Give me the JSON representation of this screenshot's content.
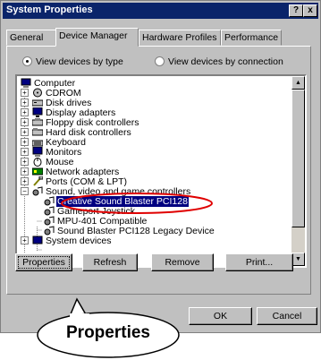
{
  "window": {
    "title": "System Properties",
    "help_button": "?",
    "close_button": "x"
  },
  "tabs": [
    {
      "label": "General"
    },
    {
      "label": "Device Manager"
    },
    {
      "label": "Hardware Profiles"
    },
    {
      "label": "Performance"
    }
  ],
  "view_options": {
    "by_type": "View devices by type",
    "by_connection": "View devices by connection",
    "selected": "by_type"
  },
  "tree": {
    "items": [
      {
        "label": "Computer",
        "icon": "computer-icon"
      },
      {
        "label": "CDROM",
        "icon": "cdrom-icon"
      },
      {
        "label": "Disk drives",
        "icon": "disk-drive-icon"
      },
      {
        "label": "Display adapters",
        "icon": "display-adapter-icon"
      },
      {
        "label": "Floppy disk controllers",
        "icon": "floppy-controller-icon"
      },
      {
        "label": "Hard disk controllers",
        "icon": "hard-disk-controller-icon"
      },
      {
        "label": "Keyboard",
        "icon": "keyboard-icon"
      },
      {
        "label": "Monitors",
        "icon": "monitor-icon"
      },
      {
        "label": "Mouse",
        "icon": "mouse-icon"
      },
      {
        "label": "Network adapters",
        "icon": "network-adapter-icon"
      },
      {
        "label": "Ports (COM & LPT)",
        "icon": "ports-icon"
      },
      {
        "label": "Sound, video and game controllers",
        "icon": "sound-controller-icon"
      },
      {
        "label": "Creative Sound Blaster PCI128",
        "icon": "sound-device-icon",
        "selected": true
      },
      {
        "label": "Gameport Joystick",
        "icon": "sound-device-icon"
      },
      {
        "label": "MPU-401 Compatible",
        "icon": "sound-device-icon"
      },
      {
        "label": "Sound Blaster PCI128 Legacy Device",
        "icon": "sound-device-icon"
      },
      {
        "label": "System devices",
        "icon": "system-devices-icon"
      }
    ]
  },
  "buttons": {
    "properties": "Properties",
    "refresh": "Refresh",
    "remove": "Remove",
    "print": "Print...",
    "ok": "OK",
    "cancel": "Cancel"
  },
  "callout": {
    "text": "Properties"
  },
  "colors": {
    "title_bar": "#0a246a",
    "selection": "#000080",
    "highlight_ring": "#e00000"
  }
}
